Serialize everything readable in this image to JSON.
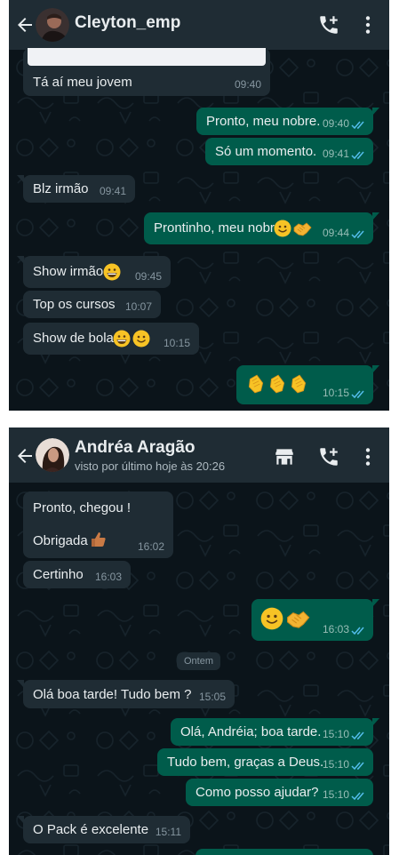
{
  "chat1": {
    "contact_name": "Cleyton_emp",
    "messages": [
      {
        "text": "Tá aí meu jovem",
        "time": "09:40"
      },
      {
        "text": "Pronto, meu nobre.",
        "time": "09:40"
      },
      {
        "text": "Só um momento.",
        "time": "09:41"
      },
      {
        "text": "Blz irmão",
        "time": "09:41"
      },
      {
        "text": "Prontinho, meu nobre",
        "time": "09:44"
      },
      {
        "text": "Show irmão",
        "time": "09:45"
      },
      {
        "text": "Top os cursos",
        "time": "10:07"
      },
      {
        "text": "Show de bola",
        "time": "10:15"
      },
      {
        "text": "",
        "time": "10:15"
      }
    ]
  },
  "chat2": {
    "contact_name": "Andréa Aragão",
    "last_seen": "visto por último hoje às 20:26",
    "day_separator": "Ontem",
    "messages": [
      {
        "line1": "Pronto, chegou !",
        "line2": "Obrigada",
        "time": "16:02"
      },
      {
        "text": "Certinho",
        "time": "16:03"
      },
      {
        "text": "",
        "time": "16:03"
      },
      {
        "text": "Olá  boa tarde! Tudo bem  ?",
        "time": "15:05"
      },
      {
        "text": "Olá, Andréia; boa tarde.",
        "time": "15:10"
      },
      {
        "text": "Tudo bem, graças a Deus.",
        "time": "15:10"
      },
      {
        "text": "Como posso ajudar?",
        "time": "15:10"
      },
      {
        "text": "O Pack é excelente",
        "time": "15:11"
      }
    ]
  },
  "icons": [
    "back-arrow-icon",
    "add-call-icon",
    "more-vert-icon",
    "storefront-icon",
    "double-check-icon",
    "smile-emoji",
    "handshake-emoji",
    "grin-emoji",
    "thumbs-up-emoji",
    "clap-emoji"
  ],
  "colors": {
    "header": "#1f2c34",
    "background": "#0b141a",
    "incoming": "#1f2c34",
    "outgoing": "#005c4b",
    "read_ticks": "#53bdeb"
  }
}
